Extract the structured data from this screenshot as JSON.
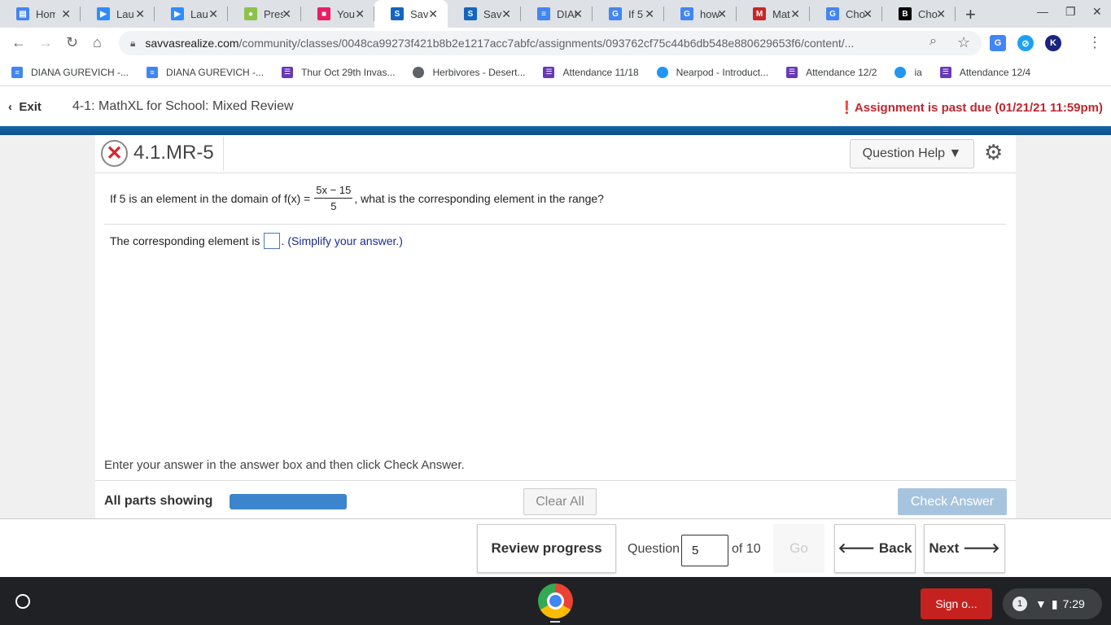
{
  "browser": {
    "tabs": [
      {
        "label": "Hom",
        "favicon": "doc-icon",
        "color": "#4285f4",
        "glyph": "▤"
      },
      {
        "label": "Lau",
        "favicon": "zoom-icon",
        "color": "#2d8cff",
        "glyph": "▶"
      },
      {
        "label": "Lau",
        "favicon": "zoom-icon",
        "color": "#2d8cff",
        "glyph": "▶"
      },
      {
        "label": "Pres",
        "favicon": "pear-icon",
        "color": "#8bc34a",
        "glyph": "●"
      },
      {
        "label": "You",
        "favicon": "person-icon",
        "color": "#e91e63",
        "glyph": "■"
      },
      {
        "label": "Sav",
        "favicon": "savvas-icon",
        "color": "#1565c0",
        "glyph": "S",
        "active": true
      },
      {
        "label": "Sav",
        "favicon": "savvas-icon",
        "color": "#1565c0",
        "glyph": "S"
      },
      {
        "label": "DIAN",
        "favicon": "docs-icon",
        "color": "#4285f4",
        "glyph": "≡"
      },
      {
        "label": "If 5",
        "favicon": "google-icon",
        "color": "#4285f4",
        "glyph": "G"
      },
      {
        "label": "how",
        "favicon": "google-icon",
        "color": "#4285f4",
        "glyph": "G"
      },
      {
        "label": "Mat",
        "favicon": "mathxl-icon",
        "color": "#c62828",
        "glyph": "M"
      },
      {
        "label": "Cho",
        "favicon": "google-icon",
        "color": "#4285f4",
        "glyph": "G"
      },
      {
        "label": "Cho",
        "favicon": "brainly-icon",
        "color": "#000000",
        "glyph": "B"
      }
    ],
    "new_tab": "+",
    "url_host": "savvasrealize.com",
    "url_path": "/community/classes/0048ca99273f421b8b2e1217acc7abfc/assignments/093762cf75c44b6db548e880629653f6/content/...",
    "bookmarks": [
      {
        "label": "DIANA GUREVICH -...",
        "icon": "docs-icon",
        "color": "#4285f4"
      },
      {
        "label": "DIANA GUREVICH -...",
        "icon": "docs-icon",
        "color": "#4285f4"
      },
      {
        "label": "Thur Oct 29th Invas...",
        "icon": "form-icon",
        "color": "#673ab7"
      },
      {
        "label": "Herbivores - Desert...",
        "icon": "globe-icon",
        "color": "#5f6368"
      },
      {
        "label": "Attendance 11/18",
        "icon": "form-icon",
        "color": "#673ab7"
      },
      {
        "label": "Nearpod - Introduct...",
        "icon": "nearpod-icon",
        "color": "#2196f3"
      },
      {
        "label": "Attendance 12/2",
        "icon": "form-icon",
        "color": "#673ab7"
      },
      {
        "label": "ia",
        "icon": "nearpod-icon",
        "color": "#2196f3"
      },
      {
        "label": "Attendance 12/4",
        "icon": "form-icon",
        "color": "#673ab7"
      }
    ],
    "profile_initial": "K"
  },
  "app": {
    "exit_label": "Exit",
    "assignment_title": "4-1: MathXL for School: Mixed Review",
    "past_due": "Assignment is past due (01/21/21 11:59pm)"
  },
  "question": {
    "id": "4.1.MR-5",
    "help_label": "Question Help",
    "prompt_before": "If 5 is an element in the domain of f(x) =",
    "frac_num": "5x − 15",
    "frac_den": "5",
    "prompt_after": ", what is the corresponding element in the range?",
    "answer_before": "The corresponding element is",
    "answer_after": ".",
    "hint": "(Simplify your answer.)",
    "instruction": "Enter your answer in the answer box and then click Check Answer.",
    "parts_label": "All parts showing",
    "progress_fraction": 1.0,
    "clear_all": "Clear All",
    "check_answer": "Check Answer"
  },
  "nav": {
    "review_progress": "Review progress",
    "question_label": "Question",
    "question_number": "5",
    "of_label": "of 10",
    "go_label": "Go",
    "back_label": "Back",
    "next_label": "Next"
  },
  "shelf": {
    "sign_out": "Sign o...",
    "notification_count": "1",
    "time": "7:29"
  }
}
